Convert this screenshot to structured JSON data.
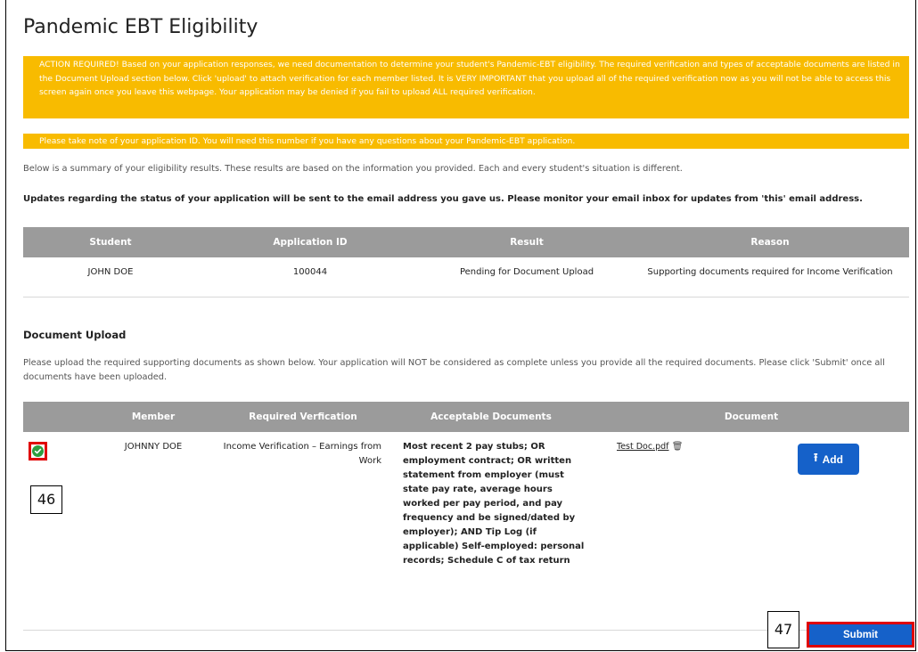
{
  "page": {
    "title": "Pandemic EBT Eligibility",
    "alert_action": "ACTION REQUIRED! Based on your application responses, we need documentation to determine your student's Pandemic-EBT eligibility. The required verification and types of acceptable documents are listed in the Document Upload section below. Click 'upload' to attach verification for each member listed. It is VERY IMPORTANT that you upload all of the required verification now as you will not be able to access this screen again once you leave this webpage. Your application may be denied if you fail to upload ALL required verification.",
    "alert_id": "Please take note of your application ID. You will need this number if you have any questions about your Pandemic-EBT application.",
    "summary_text": "Below is a summary of your eligibility results. These results are based on the information you provided. Each and every student's situation is different.",
    "updates_text": "Updates regarding the status of your application will be sent to the email address you gave us. Please monitor your email inbox for updates from 'this' email address."
  },
  "results_table": {
    "headers": [
      "Student",
      "Application ID",
      "Result",
      "Reason"
    ],
    "rows": [
      {
        "student": "JOHN DOE",
        "application_id": "100044",
        "result": "Pending for Document Upload",
        "reason": "Supporting documents required for Income Verification"
      }
    ]
  },
  "document_upload": {
    "heading": "Document Upload",
    "instructions": "Please upload the required supporting documents as shown below. Your application will NOT be considered as complete unless you provide all the required documents. Please click 'Submit' once all documents have been uploaded.",
    "headers": [
      "Member",
      "Required Verfication",
      "Acceptable Documents",
      "Document"
    ],
    "rows": [
      {
        "member": "JOHNNY DOE",
        "required_verification": "Income Verification – Earnings from Work",
        "acceptable_documents": "Most recent 2 pay stubs; OR employment contract; OR written statement from employer (must state pay rate, average hours worked per pay period, and pay frequency and be signed/dated by employer); AND Tip Log (if applicable) Self-employed: personal records; Schedule C of tax return",
        "document_name": "Test Doc.pdf",
        "add_label": "Add"
      }
    ],
    "submit_label": "Submit"
  },
  "callouts": {
    "first": "46",
    "second": "47"
  },
  "icons": {
    "status": "check-circle-icon",
    "delete": "trash-icon",
    "upload": "upload-icon"
  },
  "colors": {
    "alert_bg": "#f8bb00",
    "header_bg": "#9b9b9b",
    "primary": "#1561c9",
    "success": "#2e9d3f",
    "highlight": "#e00000"
  }
}
